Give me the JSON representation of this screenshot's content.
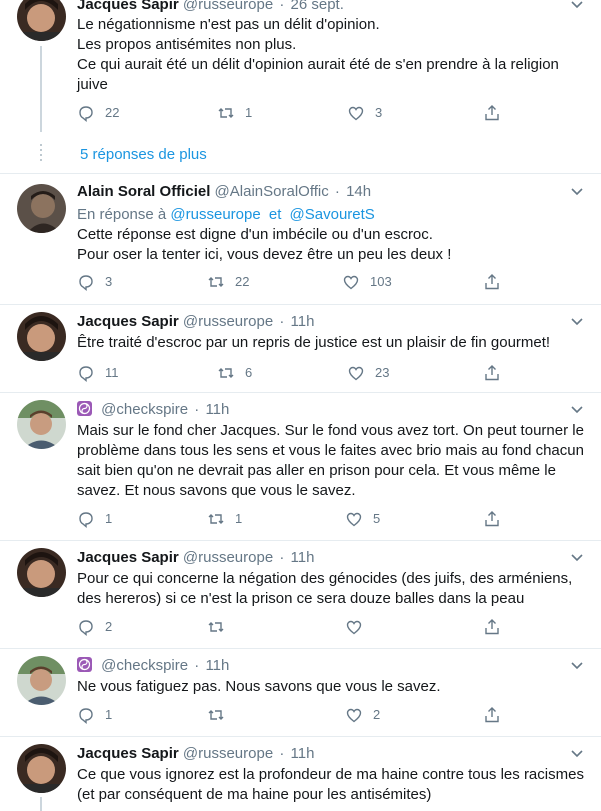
{
  "tweets": [
    {
      "name": "Jacques Sapir",
      "handle": "@russeurope",
      "time": "26 sept.",
      "avatar": "avatar-jacques-sapir",
      "lines": [
        "Le négationnisme n'est pas un délit d'opinion.",
        "Les propos antisémites non plus.",
        "Ce qui aurait été un délit d'opinion aurait été de s'en prendre à la religion",
        "juive"
      ],
      "replies": "22",
      "retweets": "1",
      "likes": "3"
    },
    {
      "name": "Alain Soral Officiel",
      "handle": "@AlainSoralOffic",
      "time": "14h",
      "avatar": "avatar-alain-soral",
      "reply_prefix": "En réponse à",
      "reply_mention_1": "@russeurope",
      "reply_and": "et",
      "reply_mention_2": "@SavouretS",
      "lines": [
        "Cette réponse est digne d'un imbécile ou d'un escroc.",
        "Pour oser la tenter ici, vous devez être un peu les deux !"
      ],
      "replies": "3",
      "retweets": "22",
      "likes": "103"
    },
    {
      "name": "Jacques Sapir",
      "handle": "@russeurope",
      "time": "11h",
      "avatar": "avatar-jacques-sapir",
      "lines": [
        "Être traité d'escroc par un repris de justice est un plaisir de fin gourmet!"
      ],
      "replies": "11",
      "retweets": "6",
      "likes": "23"
    },
    {
      "name": "",
      "handle": "@checkspire",
      "time": "11h",
      "avatar": "avatar-checkspire",
      "lines": [
        "Mais sur le fond cher Jacques. Sur le fond vous avez tort. On peut tourner le",
        "problème dans tous les sens et vous le faites avec brio mais au fond chacun",
        "sait bien qu'on ne devrait pas aller en prison pour cela. Et vous même le",
        "savez. Et nous savons que vous le savez."
      ],
      "replies": "1",
      "retweets": "1",
      "likes": "5"
    },
    {
      "name": "Jacques Sapir",
      "handle": "@russeurope",
      "time": "11h",
      "avatar": "avatar-jacques-sapir",
      "lines": [
        "Pour ce qui concerne la négation des génocides (des juifs, des arméniens,",
        "des hereros) si ce n'est la prison ce sera douze balles dans la peau"
      ],
      "replies": "2",
      "retweets": "",
      "likes": ""
    },
    {
      "name": "",
      "handle": "@checkspire",
      "time": "11h",
      "avatar": "avatar-checkspire",
      "lines": [
        "Ne vous fatiguez pas. Nous savons que vous le savez."
      ],
      "replies": "1",
      "retweets": "",
      "likes": "2"
    },
    {
      "name": "Jacques Sapir",
      "handle": "@russeurope",
      "time": "11h",
      "avatar": "avatar-jacques-sapir",
      "lines": [
        "Ce que vous ignorez est la profondeur de ma haine contre tous les racismes",
        "(et par conséquent de ma haine pour les antisémites)"
      ],
      "replies": "",
      "retweets": "",
      "likes": ""
    }
  ],
  "more_replies_label": "5 réponses de plus",
  "colors": {
    "text": "#14171a",
    "muted": "#657786",
    "link": "#1b95e0",
    "border": "#e6ecf0",
    "thread_line": "#ccd6dd",
    "emoji_purple": "#9b59b6"
  },
  "icons": [
    "reply-icon",
    "retweet-icon",
    "like-icon",
    "share-icon",
    "caret-down-icon",
    "yin-yang-emoji"
  ]
}
